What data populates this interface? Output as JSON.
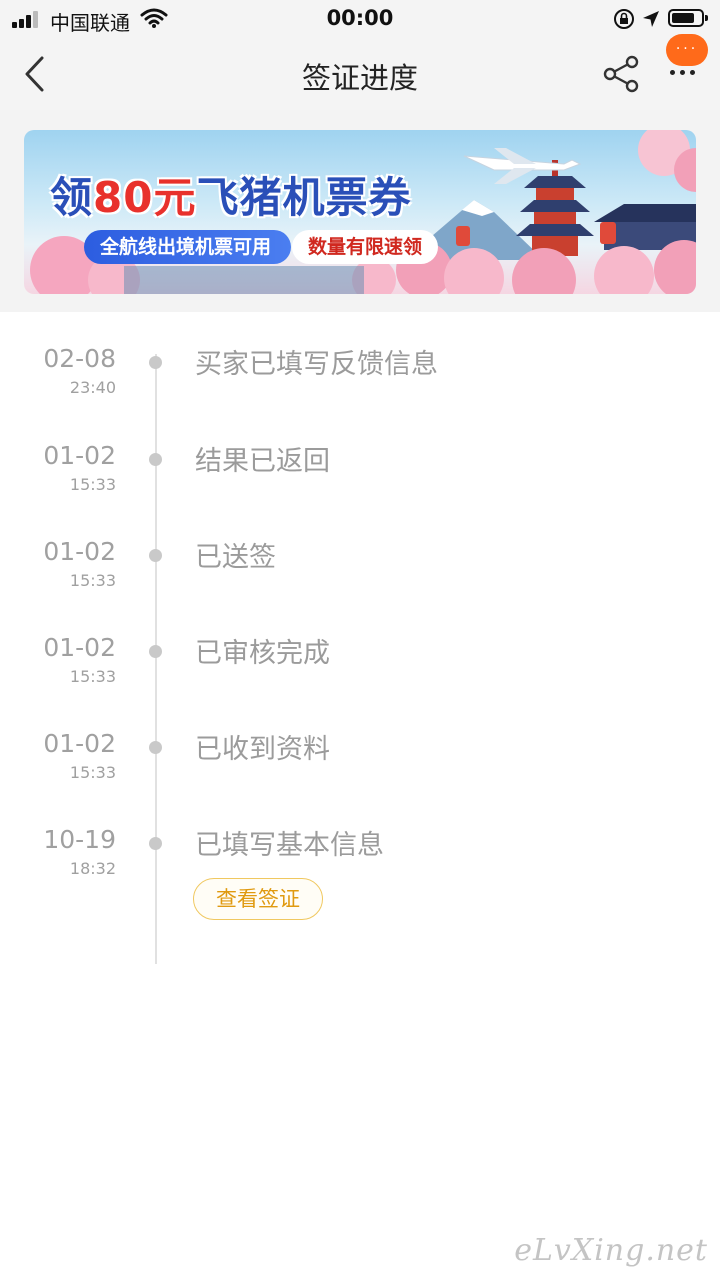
{
  "status_bar": {
    "carrier": "中国联通",
    "time": "00:00"
  },
  "nav": {
    "title": "签证进度",
    "badge": "···"
  },
  "banner": {
    "headline_prefix": "领",
    "headline_amount": "80元",
    "headline_suffix": "飞猪机票券",
    "pill_left": "全航线出境机票可用",
    "pill_right": "数量有限速领"
  },
  "timeline": {
    "items": [
      {
        "date": "02-08",
        "time": "23:40",
        "text": "买家已填写反馈信息"
      },
      {
        "date": "01-02",
        "time": "15:33",
        "text": "结果已返回"
      },
      {
        "date": "01-02",
        "time": "15:33",
        "text": "已送签"
      },
      {
        "date": "01-02",
        "time": "15:33",
        "text": "已审核完成"
      },
      {
        "date": "01-02",
        "time": "15:33",
        "text": "已收到资料"
      },
      {
        "date": "10-19",
        "time": "18:32",
        "text": "已填写基本信息"
      }
    ],
    "view_visa_button": "查看签证"
  },
  "watermark": "eLvXing.net",
  "colors": {
    "accent_orange": "#ff6a1a",
    "button_gold": "#e09a10",
    "timeline_text": "#9b9b9b"
  }
}
